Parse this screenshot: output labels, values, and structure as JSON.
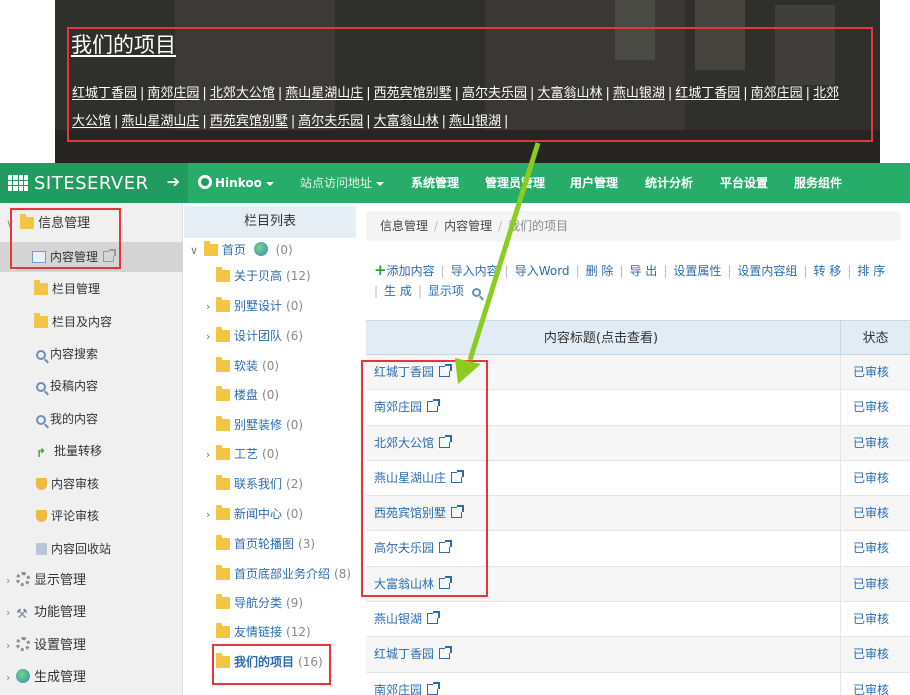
{
  "hero": {
    "title": "我们的项目",
    "links": [
      "红城丁香园",
      "南郊庄园",
      "北郊大公馆",
      "燕山星湖山庄",
      "西苑宾馆别墅",
      "高尔夫乐园",
      "大富翁山林",
      "燕山银湖",
      "红城丁香园",
      "南郊庄园",
      "北郊",
      "大公馆",
      "燕山星湖山庄",
      "西苑宾馆别墅",
      "高尔夫乐园",
      "大富翁山林",
      "燕山银湖"
    ],
    "separator": "|"
  },
  "topbar": {
    "brand": "SITESERVER",
    "site_name": "Hinkoo",
    "items": [
      "站点访问地址",
      "系统管理",
      "管理员管理",
      "用户管理",
      "统计分析",
      "平台设置",
      "服务组件"
    ]
  },
  "sidebar": {
    "groups": [
      {
        "label": "信息管理",
        "icon": "folder-icon"
      },
      {
        "label": "显示管理",
        "icon": "gear-icon"
      },
      {
        "label": "功能管理",
        "icon": "wrench-icon"
      },
      {
        "label": "设置管理",
        "icon": "gear-icon"
      },
      {
        "label": "生成管理",
        "icon": "earth-icon"
      }
    ],
    "items": [
      {
        "label": "内容管理",
        "icon": "page-icon"
      },
      {
        "label": "栏目管理",
        "icon": "folder-icon"
      },
      {
        "label": "栏目及内容",
        "icon": "folder-icon"
      },
      {
        "label": "内容搜索",
        "icon": "search-icon"
      },
      {
        "label": "投稿内容",
        "icon": "search-icon"
      },
      {
        "label": "我的内容",
        "icon": "search-icon"
      },
      {
        "label": "批量转移",
        "icon": "arrow-icon"
      },
      {
        "label": "内容审核",
        "icon": "shield-icon"
      },
      {
        "label": "评论审核",
        "icon": "shield-icon"
      },
      {
        "label": "内容回收站",
        "icon": "bin-icon"
      }
    ]
  },
  "tree": {
    "header": "栏目列表",
    "root": {
      "label": "首页",
      "count": "(0)"
    },
    "nodes": [
      {
        "label": "关于贝高",
        "count": "(12)"
      },
      {
        "label": "别墅设计",
        "count": "(0)"
      },
      {
        "label": "设计团队",
        "count": "(6)"
      },
      {
        "label": "软装",
        "count": "(0)"
      },
      {
        "label": "楼盘",
        "count": "(0)"
      },
      {
        "label": "别墅装修",
        "count": "(0)"
      },
      {
        "label": "工艺",
        "count": "(0)"
      },
      {
        "label": "联系我们",
        "count": "(2)"
      },
      {
        "label": "新闻中心",
        "count": "(0)"
      },
      {
        "label": "首页轮播图",
        "count": "(3)"
      },
      {
        "label": "首页底部业务介绍",
        "count": "(8)"
      },
      {
        "label": "导航分类",
        "count": "(9)"
      },
      {
        "label": "友情链接",
        "count": "(12)"
      },
      {
        "label": "我们的项目",
        "count": "(16)"
      }
    ]
  },
  "breadcrumb": [
    "信息管理",
    "内容管理",
    "我们的项目"
  ],
  "toolbar": {
    "buttons": [
      "添加内容",
      "导入内容",
      "导入Word",
      "删 除",
      "导 出",
      "设置属性",
      "设置内容组",
      "转 移",
      "排 序",
      "生 成",
      "显示项"
    ]
  },
  "table": {
    "headers": [
      "内容标题(点击查看)",
      "状态"
    ],
    "rows": [
      {
        "title": "红城丁香园",
        "status": "已审核"
      },
      {
        "title": "南郊庄园",
        "status": "已审核"
      },
      {
        "title": "北郊大公馆",
        "status": "已审核"
      },
      {
        "title": "燕山星湖山庄",
        "status": "已审核"
      },
      {
        "title": "西苑宾馆别墅",
        "status": "已审核"
      },
      {
        "title": "高尔夫乐园",
        "status": "已审核"
      },
      {
        "title": "大富翁山林",
        "status": "已审核"
      },
      {
        "title": "燕山银湖",
        "status": "已审核"
      },
      {
        "title": "红城丁香园",
        "status": "已审核"
      },
      {
        "title": "南郊庄园",
        "status": "已审核"
      }
    ]
  },
  "colors": {
    "nav_green": "#27ac6a",
    "brand_green": "#219c60",
    "annotation_red": "#e8353a",
    "annotation_arrow": "#8ccc1e",
    "link_blue": "#2b6cb0"
  }
}
